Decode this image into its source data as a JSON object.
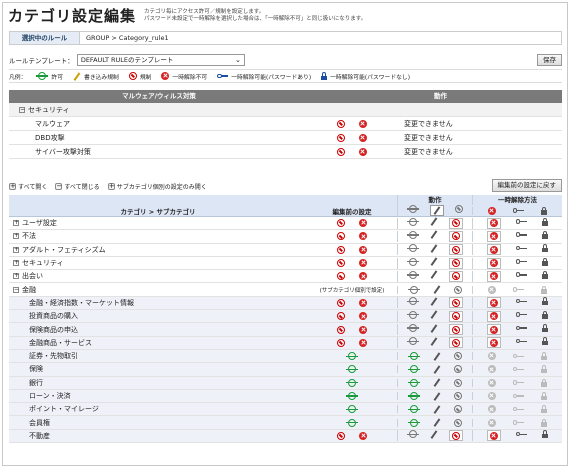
{
  "header": {
    "title": "カテゴリ設定編集",
    "note1": "カテゴリ毎にアクセス許可／規制を設定します。",
    "note2": "パスワード未設定で一時解除を選択した場合は、「一時解除不可」と同じ扱いになります。"
  },
  "rule": {
    "label": "選択中のルール",
    "value": "GROUP > Category_rule1"
  },
  "template": {
    "label": "ルールテンプレート：",
    "selected": "DEFAULT RULEのテンプレート",
    "save": "保存"
  },
  "legend": {
    "title": "凡例：",
    "allow": "許可",
    "write": "書き込み規制",
    "block": "規制",
    "notemp": "一時解除不可",
    "temppw": "一時解除可能(パスワードあり)",
    "tempnopw": "一時解除可能(パスワードなし)"
  },
  "malware": {
    "col1": "マルウェア/ウィルス対策",
    "col3": "動作",
    "group": "セキュリティ",
    "rows": [
      {
        "name": "マルウェア",
        "status": "変更できません"
      },
      {
        "name": "DBD攻撃",
        "status": "変更できません"
      },
      {
        "name": "サイバー攻撃対策",
        "status": "変更できません"
      }
    ]
  },
  "toolbar": {
    "expand": "すべて開く",
    "collapse": "すべて閉じる",
    "subcat": "サブカテゴリ個別の設定のみ開く",
    "reset": "編集前の設定に戻す"
  },
  "categories": {
    "h_cat": "カテゴリ > サブカテゴリ",
    "h_before": "編集前の設定",
    "h_action": "動作",
    "h_temp": "一時解除方法",
    "top": [
      {
        "name": "ユーザ設定"
      },
      {
        "name": "不法"
      },
      {
        "name": "アダルト・フェティシズム"
      },
      {
        "name": "セキュリティ"
      },
      {
        "name": "出会い"
      }
    ],
    "open": {
      "name": "金融",
      "note": "(サブカテゴリ個別で設定)"
    },
    "subs": [
      {
        "name": "金融・経済指数・マーケット情報",
        "state": "block"
      },
      {
        "name": "投資商品の購入",
        "state": "block"
      },
      {
        "name": "保険商品の申込",
        "state": "block"
      },
      {
        "name": "金融商品・サービス",
        "state": "block"
      },
      {
        "name": "証券・先物取引",
        "state": "allow"
      },
      {
        "name": "保険",
        "state": "allow"
      },
      {
        "name": "銀行",
        "state": "allow"
      },
      {
        "name": "ローン・決済",
        "state": "allow"
      },
      {
        "name": "ポイント・マイレージ",
        "state": "allow"
      },
      {
        "name": "会員権",
        "state": "allow"
      },
      {
        "name": "不動産",
        "state": "block"
      }
    ]
  }
}
